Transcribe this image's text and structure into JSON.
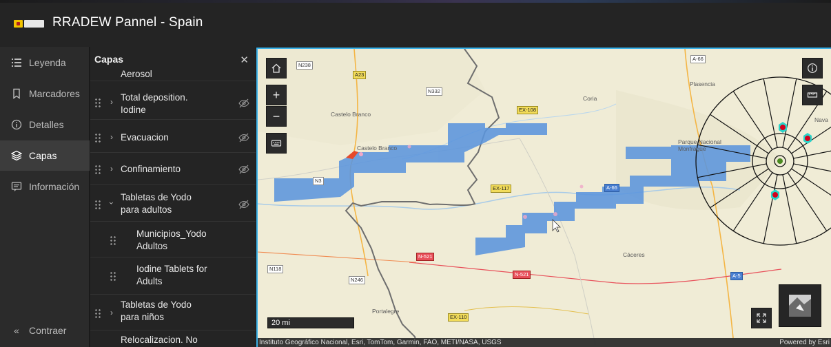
{
  "app": {
    "title": "RRADEW Pannel - Spain"
  },
  "rail": {
    "items": [
      {
        "label": "Leyenda",
        "icon": "legend-icon",
        "active": false
      },
      {
        "label": "Marcadores",
        "icon": "bookmark-icon",
        "active": false
      },
      {
        "label": "Detalles",
        "icon": "info-icon",
        "active": false
      },
      {
        "label": "Capas",
        "icon": "layers-icon",
        "active": true
      },
      {
        "label": "Información",
        "icon": "information-panel-icon",
        "active": false
      }
    ],
    "collapse_label": "Contraer"
  },
  "panel": {
    "title": "Capas",
    "close_icon": "close-icon",
    "layers": [
      {
        "label": "Aerosol"
      },
      {
        "label": "Total deposition. Iodine",
        "lines": [
          "Total deposition.",
          "Iodine"
        ]
      },
      {
        "label": "Evacuacion"
      },
      {
        "label": "Confinamiento"
      },
      {
        "label": "Tabletas de Yodo para adultos",
        "lines": [
          "Tabletas de Yodo",
          "para adultos"
        ],
        "expanded": true
      },
      {
        "label": "Municipios_Yodo Adultos",
        "lines": [
          "Municipios_Yodo",
          "Adultos"
        ],
        "sub": true
      },
      {
        "label": "Iodine Tablets for Adults",
        "lines": [
          "Iodine Tablets for",
          "Adults"
        ],
        "sub": true
      },
      {
        "label": "Tabletas de Yodo para niños",
        "lines": [
          "Tabletas de Yodo",
          "para niños"
        ]
      },
      {
        "label": "Relocalizacion. No"
      }
    ]
  },
  "map": {
    "places": [
      "Castelo Branco",
      "Castelo Branco",
      "Plasencia",
      "Coria",
      "Parque Nacional Monfragüe",
      "Cáceres",
      "Portalegre",
      "Nava"
    ],
    "roads": [
      "N238",
      "A23",
      "N332",
      "EX-108",
      "A-66",
      "EX-117",
      "N3",
      "A-66",
      "N118",
      "N-521",
      "N-521",
      "N246",
      "A-5",
      "EX-110"
    ],
    "scale_label": "20 mi",
    "attribution": "Instituto Geográfico Nacional, Esri, TomTom, Garmin, FAO, METI/NASA, USGS",
    "powered_by": "Powered by Esri",
    "colors": {
      "plume": "#5b95dd",
      "accent_border": "#3ab1e8",
      "marker": "#d4001c",
      "marker_ring": "#2ad3c8"
    }
  }
}
